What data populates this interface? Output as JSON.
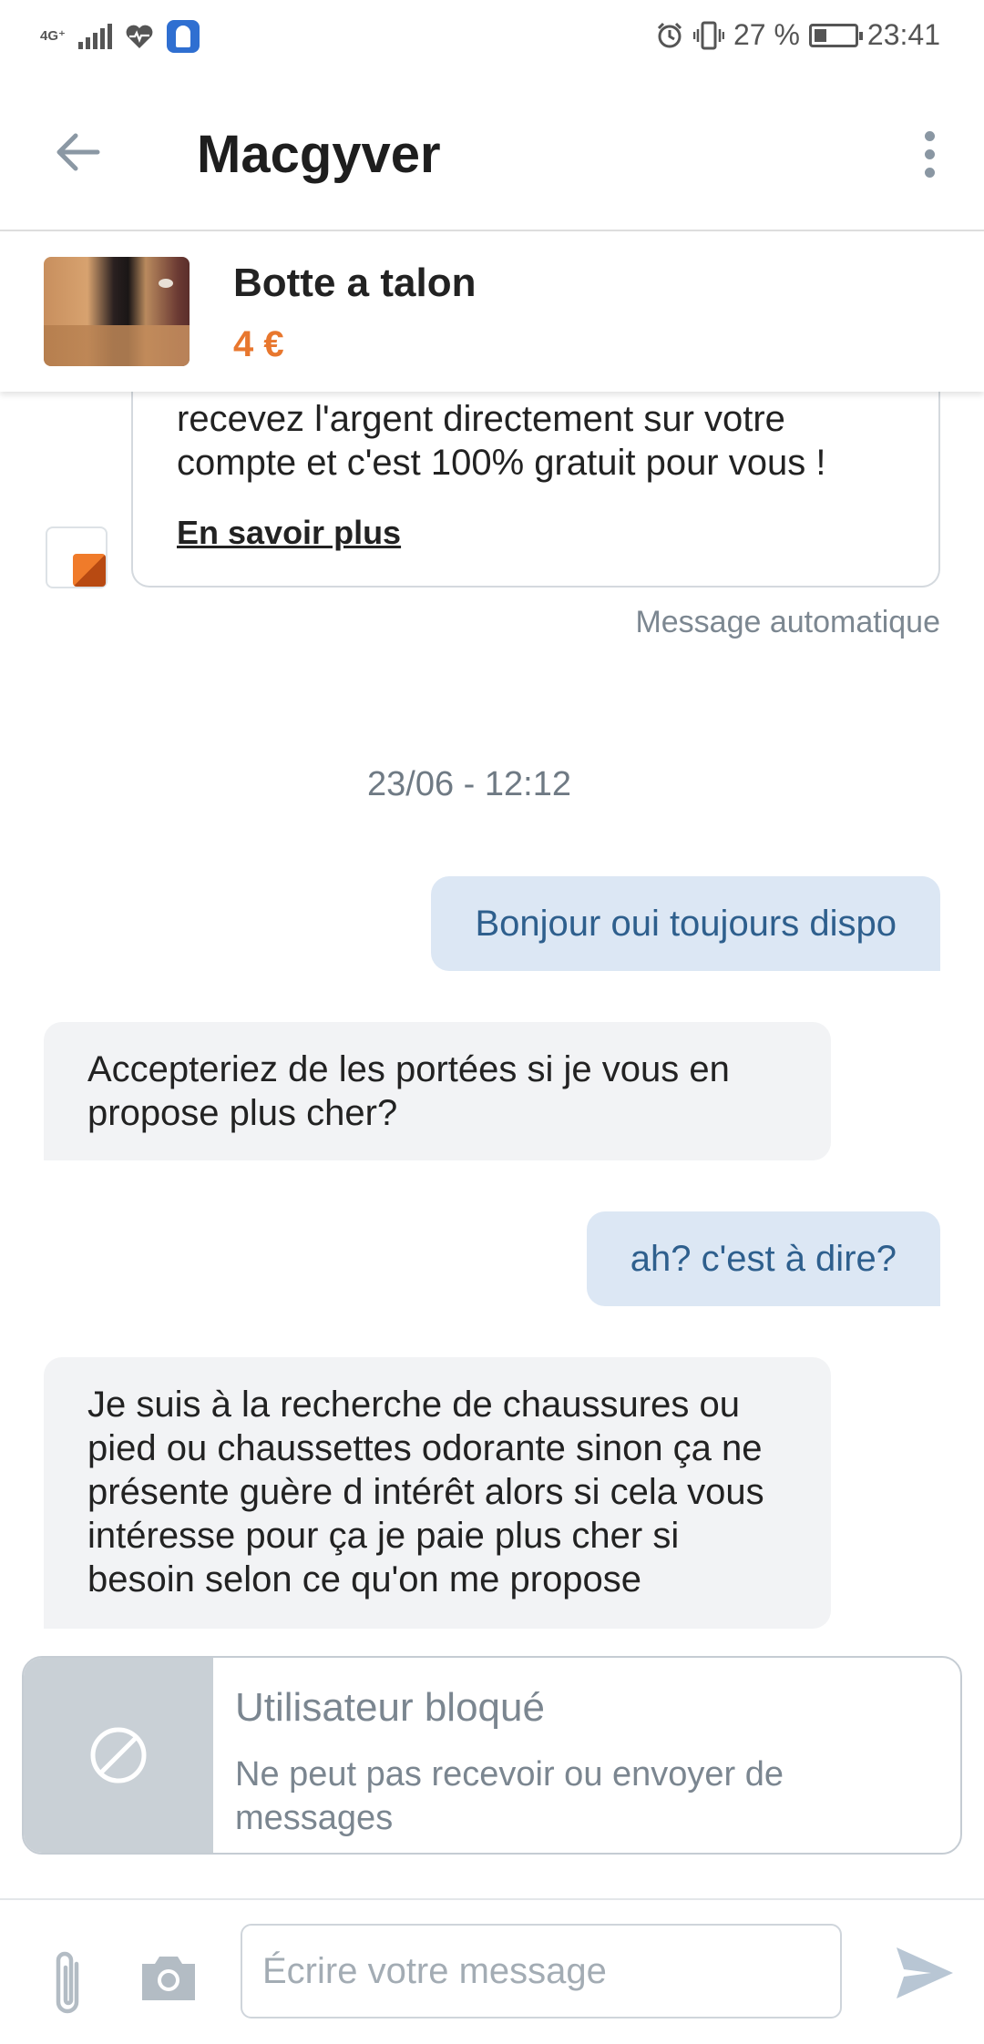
{
  "status_bar": {
    "network": "4G⁺",
    "battery": "27 %",
    "time": "23:41"
  },
  "header": {
    "title": "Macgyver"
  },
  "item": {
    "title": "Botte a talon",
    "price": "4 €"
  },
  "auto_message": {
    "text": "recevez l'argent directement sur votre compte et c'est 100% gratuit pour vous !",
    "link": "En savoir plus",
    "caption": "Message automatique"
  },
  "date_separator": "23/06 - 12:12",
  "messages": [
    {
      "direction": "outgoing",
      "text": "Bonjour oui toujours dispo"
    },
    {
      "direction": "incoming",
      "text": "Accepteriez de les portées si je vous en propose plus cher?"
    },
    {
      "direction": "outgoing",
      "text": "ah? c'est à dire?"
    },
    {
      "direction": "incoming",
      "text": "Je suis à la recherche de chaussures ou pied ou chaussettes odorante sinon ça ne présente guère d intérêt alors si cela vous intéresse pour ça je paie plus cher si besoin selon ce qu'on me propose"
    }
  ],
  "blocked": {
    "title": "Utilisateur bloqué",
    "subtitle": "Ne peut pas recevoir ou envoyer de messages"
  },
  "composer": {
    "placeholder": "Écrire votre message"
  },
  "colors": {
    "price": "#e8772e",
    "outgoing_bubble": "#dce7f4",
    "outgoing_text": "#2e5f8d",
    "incoming_bubble": "#f2f3f5",
    "blocked_side": "#c9d0d6"
  }
}
